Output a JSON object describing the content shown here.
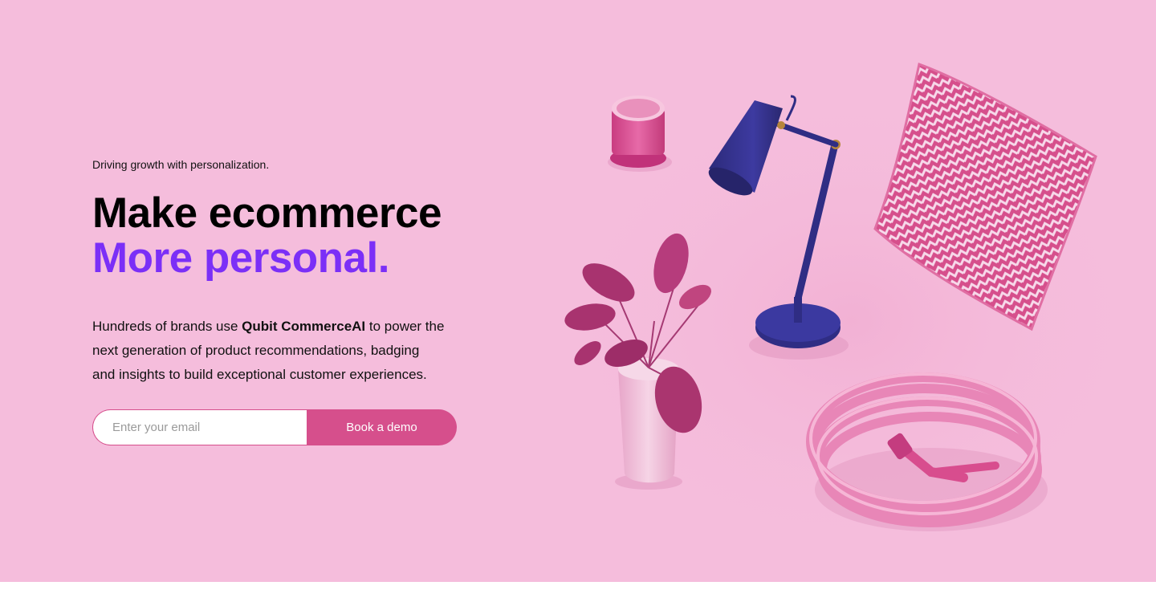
{
  "hero": {
    "eyebrow": "Driving growth with personalization.",
    "headline_line1": "Make ecommerce",
    "headline_line2": "More personal.",
    "body_prefix": "Hundreds of brands use ",
    "body_brand": "Qubit CommerceAI",
    "body_suffix": "  to power the next generation of product recommendations, badging and insights to build exceptional customer experiences."
  },
  "form": {
    "email_placeholder": "Enter your email",
    "submit_label": "Book a demo"
  },
  "colors": {
    "background": "#f5bddc",
    "accent_purple": "#7b2ff7",
    "button_pink": "#d64f8c"
  },
  "illustration": {
    "items": [
      "candle",
      "desk-lamp",
      "pillow",
      "potted-plant",
      "garden-hose"
    ]
  }
}
